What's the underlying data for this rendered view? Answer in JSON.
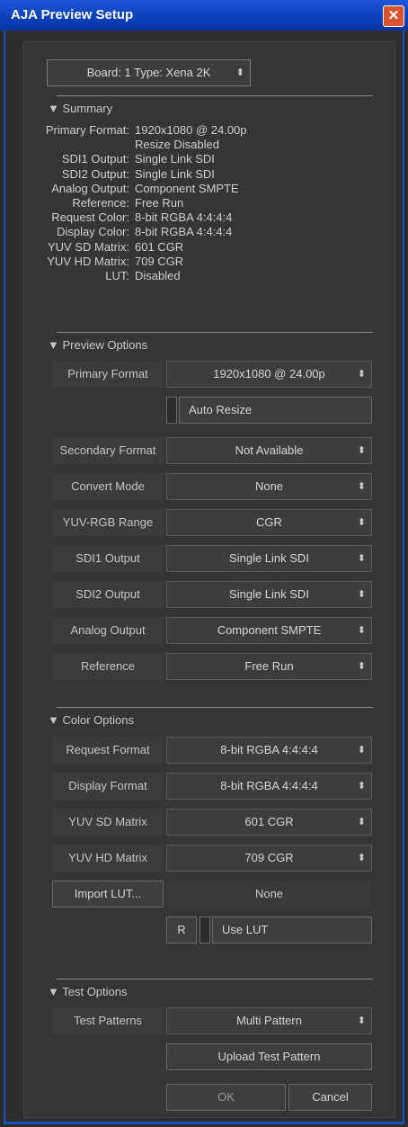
{
  "window": {
    "title": "AJA Preview Setup",
    "close_glyph": "✕"
  },
  "board": {
    "value": "Board: 1 Type: Xena 2K"
  },
  "summary": {
    "header": "▼ Summary",
    "rows": [
      {
        "key": "Primary Format:",
        "value": "1920x1080 @ 24.00p"
      },
      {
        "key": "",
        "value": "Resize Disabled"
      },
      {
        "key": "SDI1 Output:",
        "value": "Single Link SDI"
      },
      {
        "key": "SDI2 Output:",
        "value": "Single Link SDI"
      },
      {
        "key": "Analog Output:",
        "value": "Component SMPTE"
      },
      {
        "key": "Reference:",
        "value": "Free Run"
      },
      {
        "key": "Request Color:",
        "value": "8-bit RGBA 4:4:4:4"
      },
      {
        "key": "Display Color:",
        "value": "8-bit RGBA 4:4:4:4"
      },
      {
        "key": "YUV SD Matrix:",
        "value": "601 CGR"
      },
      {
        "key": "YUV HD Matrix:",
        "value": "709 CGR"
      },
      {
        "key": "LUT:",
        "value": "Disabled"
      }
    ]
  },
  "preview": {
    "header": "▼ Preview Options",
    "primary_format": {
      "label": "Primary Format",
      "value": "1920x1080 @ 24.00p"
    },
    "auto_resize": "Auto Resize",
    "secondary_format": {
      "label": "Secondary Format",
      "value": "Not Available"
    },
    "convert_mode": {
      "label": "Convert Mode",
      "value": "None"
    },
    "yuv_rgb_range": {
      "label": "YUV-RGB Range",
      "value": "CGR"
    },
    "sdi1": {
      "label": "SDI1 Output",
      "value": "Single Link SDI"
    },
    "sdi2": {
      "label": "SDI2 Output",
      "value": "Single Link SDI"
    },
    "analog": {
      "label": "Analog Output",
      "value": "Component SMPTE"
    },
    "reference": {
      "label": "Reference",
      "value": "Free Run"
    }
  },
  "color": {
    "header": "▼ Color Options",
    "request_format": {
      "label": "Request Format",
      "value": "8-bit RGBA 4:4:4:4"
    },
    "display_format": {
      "label": "Display Format",
      "value": "8-bit RGBA 4:4:4:4"
    },
    "yuv_sd": {
      "label": "YUV SD Matrix",
      "value": "601 CGR"
    },
    "yuv_hd": {
      "label": "YUV HD Matrix",
      "value": "709 CGR"
    },
    "import_lut": "Import LUT...",
    "lut_value": "None",
    "r_button": "R",
    "use_lut": "Use LUT"
  },
  "test": {
    "header": "▼ Test Options",
    "patterns": {
      "label": "Test Patterns",
      "value": "Multi Pattern"
    },
    "upload": "Upload Test Pattern"
  },
  "footer": {
    "ok": "OK",
    "cancel": "Cancel"
  },
  "icons": {
    "dropdown": "⬍"
  }
}
